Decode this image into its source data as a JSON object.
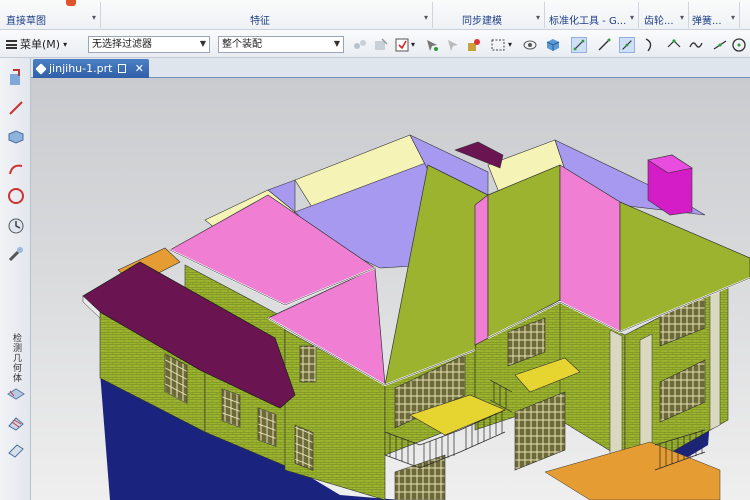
{
  "ribbon": {
    "groups": [
      "直接草图",
      "特征",
      "同步建模",
      "标准化工具 - G...",
      "齿轮...",
      "弹簧..."
    ]
  },
  "toolbar": {
    "menu_label": "菜单(M)",
    "filter_value": "无选择过滤器",
    "scope_value": "整个装配"
  },
  "leftbar": {
    "vertical_label": "检测几何体"
  },
  "tab": {
    "filename": "jinjihu-1.prt"
  },
  "colors": {
    "wall": "#9bb32e",
    "roof_pink": "#f07fd4",
    "roof_lavender": "#a899f0",
    "roof_purple": "#6a1452",
    "chimney": "#d41dc6",
    "balcony_yellow": "#e6d531",
    "base_navy": "#1a237e",
    "fascia_cream": "#f5f3b6",
    "floor_orange": "#e59c33"
  }
}
